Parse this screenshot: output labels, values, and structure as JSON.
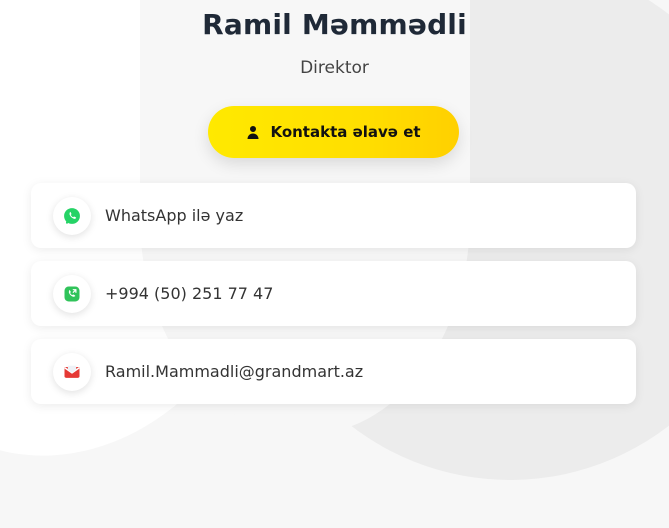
{
  "profile": {
    "name": "Ramil Məmmədli",
    "title": "Direktor"
  },
  "cta": {
    "label": "Kontakta əlavə et",
    "icon": "person-icon"
  },
  "contacts": [
    {
      "type": "whatsapp",
      "icon": "whatsapp-icon",
      "label": "WhatsApp ilə yaz",
      "color": "#25D366"
    },
    {
      "type": "phone",
      "icon": "phone-icon",
      "label": "+994 (50) 251 77 47",
      "color": "#30C35A"
    },
    {
      "type": "email",
      "icon": "mail-icon",
      "label": "Ramil.Mammadli@grandmart.az",
      "color": "#E53935"
    }
  ],
  "colors": {
    "accent": "#FFE600",
    "background": "#F7F7F7",
    "cardBackground": "#FFFFFF",
    "heading": "#1F2937"
  }
}
